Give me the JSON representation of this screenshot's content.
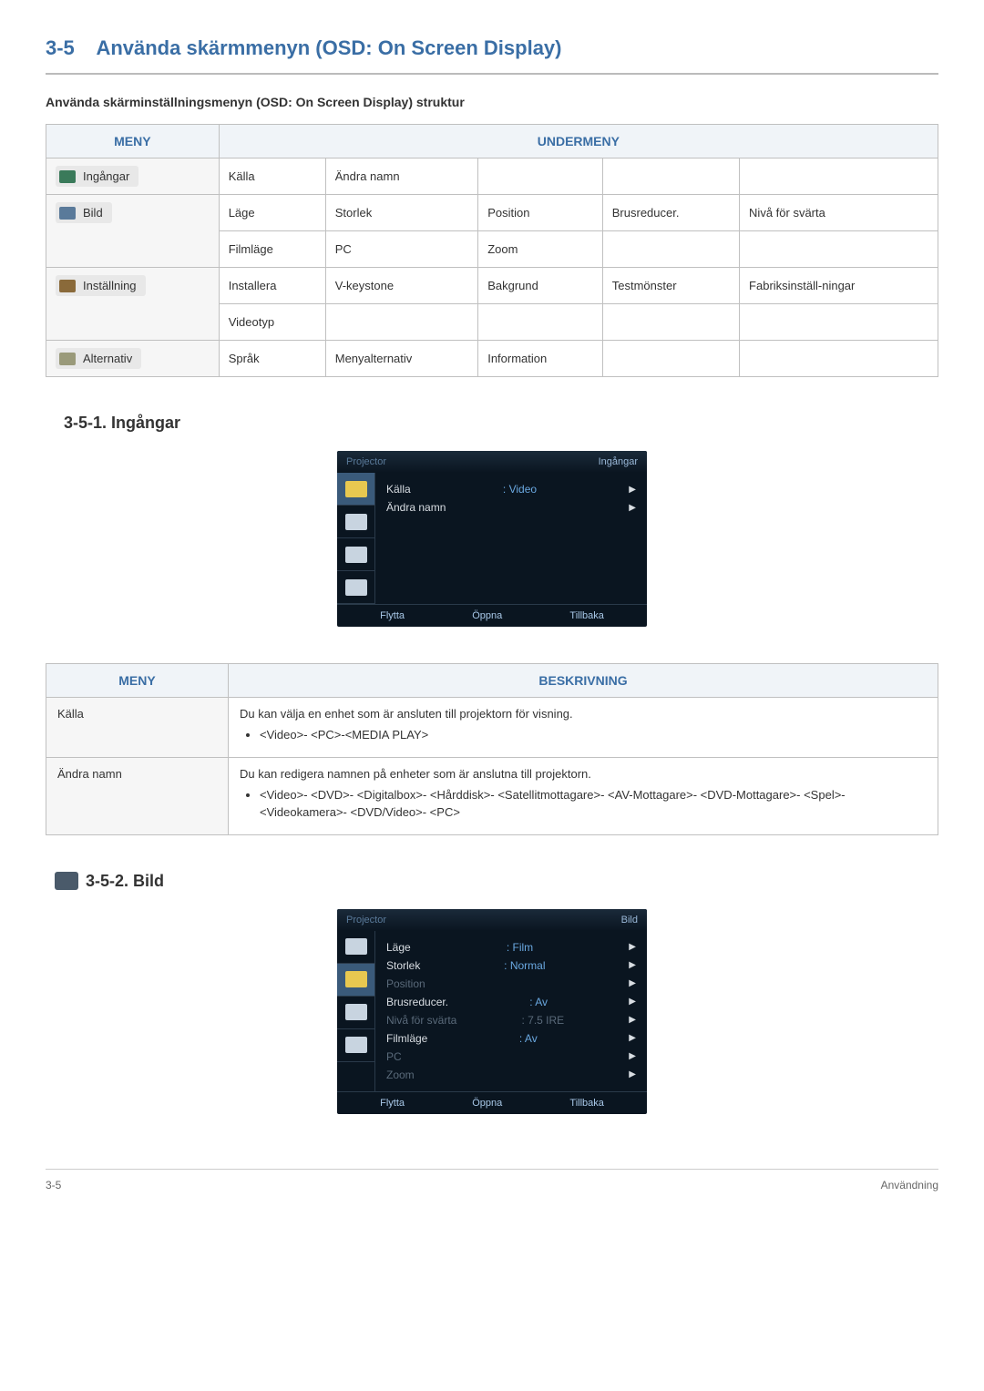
{
  "section": {
    "number": "3-5",
    "title": "Använda skärmmenyn (OSD: On Screen Display)"
  },
  "structureHeading": "Använda skärminställningsmenyn (OSD: On Screen Display) struktur",
  "structHeaders": {
    "menu": "MENY",
    "submenu": "UNDERMENY"
  },
  "structRows": {
    "row0": {
      "menu": "Ingångar",
      "c0": "Källa",
      "c1": "Ändra namn",
      "c2": "",
      "c3": "",
      "c4": ""
    },
    "row1": {
      "menu": "Bild",
      "c0": "Läge",
      "c1": "Storlek",
      "c2": "Position",
      "c3": "Brusreducer.",
      "c4": "Nivå för svärta"
    },
    "row2": {
      "c0": "Filmläge",
      "c1": "PC",
      "c2": "Zoom",
      "c3": "",
      "c4": ""
    },
    "row3": {
      "menu": "Inställning",
      "c0": "Installera",
      "c1": "V-keystone",
      "c2": "Bakgrund",
      "c3": "Testmönster",
      "c4": "Fabriksinställ-ningar"
    },
    "row4": {
      "c0": "Videotyp",
      "c1": "",
      "c2": "",
      "c3": "",
      "c4": ""
    },
    "row5": {
      "menu": "Alternativ",
      "c0": "Språk",
      "c1": "Menyalternativ",
      "c2": "Information",
      "c3": "",
      "c4": ""
    }
  },
  "sub1": {
    "title": "3-5-1. Ingångar"
  },
  "osd1": {
    "projector": "Projector",
    "headerRight": "Ingångar",
    "rows": {
      "r0": {
        "label": "Källa",
        "value": ": Video"
      },
      "r1": {
        "label": "Ändra namn",
        "value": ""
      }
    },
    "footer": {
      "move": "Flytta",
      "open": "Öppna",
      "back": "Tillbaka"
    }
  },
  "descHeaders": {
    "menu": "MENY",
    "desc": "BESKRIVNING"
  },
  "descRows": {
    "r0": {
      "menu": "Källa",
      "text": "Du kan välja en enhet som är ansluten till projektorn för visning.",
      "li0": "<Video>- <PC>-<MEDIA PLAY>"
    },
    "r1": {
      "menu": "Ändra namn",
      "text": "Du kan redigera namnen på enheter som är anslutna till projektorn.",
      "li0": "<Video>- <DVD>- <Digitalbox>- <Hårddisk>- <Satellitmottagare>- <AV-Mottagare>- <DVD-Mottagare>- <Spel>- <Videokamera>- <DVD/Video>- <PC>"
    }
  },
  "sub2": {
    "title": "3-5-2. Bild"
  },
  "osd2": {
    "projector": "Projector",
    "headerRight": "Bild",
    "rows": {
      "r0": {
        "label": "Läge",
        "value": ": Film"
      },
      "r1": {
        "label": "Storlek",
        "value": ": Normal"
      },
      "r2": {
        "label": "Position",
        "value": ""
      },
      "r3": {
        "label": "Brusreducer.",
        "value": ": Av"
      },
      "r4": {
        "label": "Nivå för svärta",
        "value": ": 7.5 IRE"
      },
      "r5": {
        "label": "Filmläge",
        "value": ": Av"
      },
      "r6": {
        "label": "PC",
        "value": ""
      },
      "r7": {
        "label": "Zoom",
        "value": ""
      }
    },
    "footer": {
      "move": "Flytta",
      "open": "Öppna",
      "back": "Tillbaka"
    }
  },
  "footer": {
    "left": "3-5",
    "right": "Användning"
  }
}
